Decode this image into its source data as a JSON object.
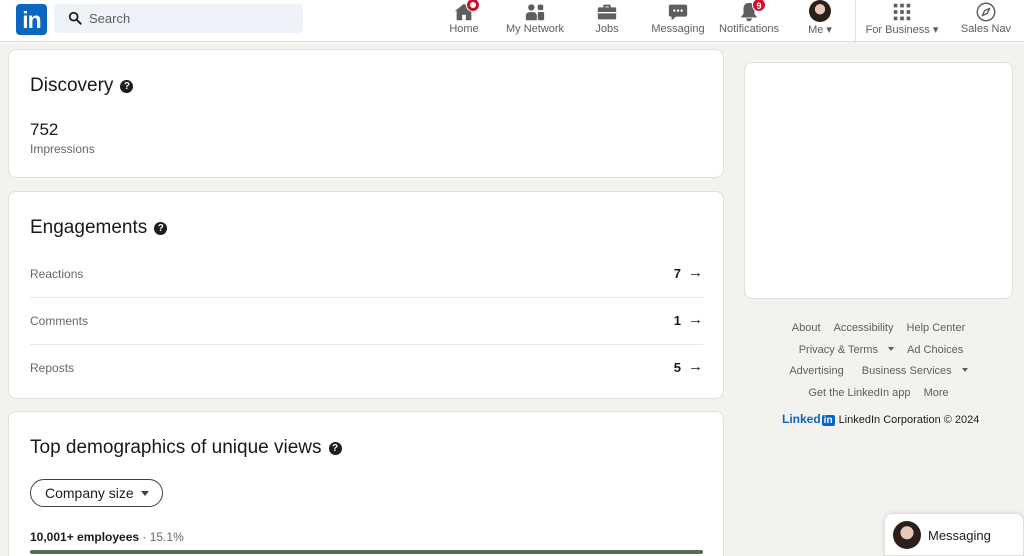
{
  "brand": {
    "logo_text": "in",
    "color": "#0a66c2"
  },
  "search": {
    "placeholder": "Search"
  },
  "nav": {
    "items": [
      {
        "label": "Home",
        "badge": ""
      },
      {
        "label": "My Network",
        "badge": ""
      },
      {
        "label": "Jobs",
        "badge": ""
      },
      {
        "label": "Messaging",
        "badge": ""
      },
      {
        "label": "Notifications",
        "badge": "9"
      },
      {
        "label": "Me",
        "badge": ""
      },
      {
        "label": "For Business",
        "badge": ""
      },
      {
        "label": "Sales Nav",
        "badge": ""
      }
    ]
  },
  "discovery": {
    "title": "Discovery",
    "impressions_value": "752",
    "impressions_label": "Impressions"
  },
  "engagements": {
    "title": "Engagements",
    "rows": [
      {
        "label": "Reactions",
        "value": "7"
      },
      {
        "label": "Comments",
        "value": "1"
      },
      {
        "label": "Reposts",
        "value": "5"
      }
    ]
  },
  "demographics": {
    "title": "Top demographics of unique views",
    "filter_label": "Company size",
    "top_item": {
      "label": "10,001+ employees",
      "separator": " · ",
      "percent": "15.1%"
    }
  },
  "footer": {
    "links": [
      "About",
      "Accessibility",
      "Help Center",
      "Privacy & Terms",
      "Ad Choices",
      "Advertising",
      "Business Services",
      "Get the LinkedIn app",
      "More"
    ],
    "logo_word": "Linked",
    "logo_box": "in",
    "copyright": "LinkedIn Corporation © 2024"
  },
  "messaging_bar": {
    "label": "Messaging"
  },
  "colors": {
    "badge": "#cb112d",
    "background": "#f4f2ee"
  }
}
